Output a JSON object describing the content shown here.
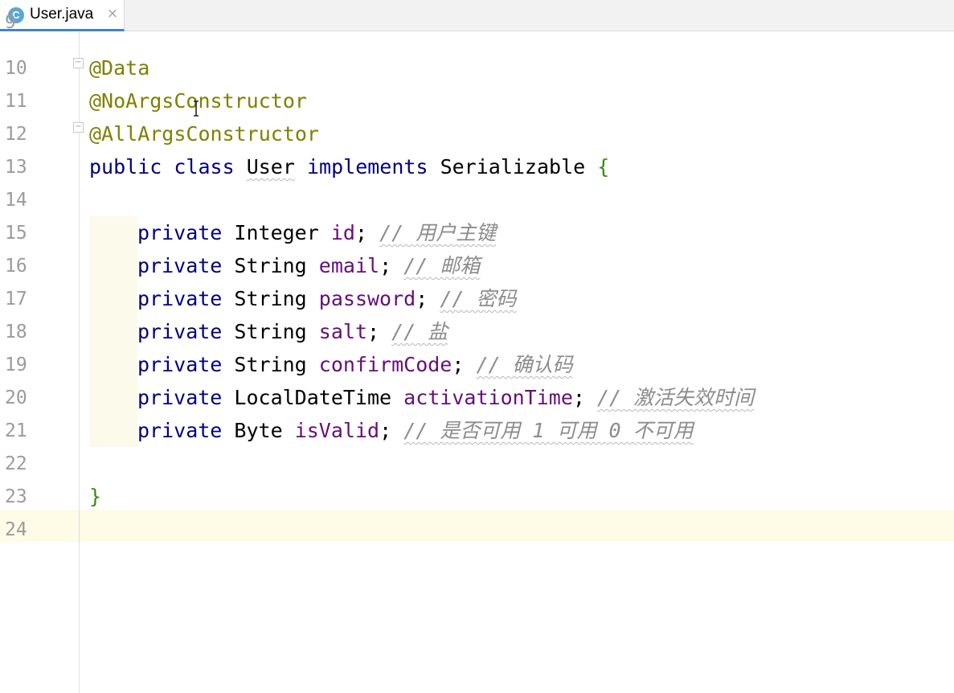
{
  "tab": {
    "icon_letter": "C",
    "title": "User.java",
    "close": "×"
  },
  "colors": {
    "keyword": "#000080",
    "annotation": "#808000",
    "field": "#660e7a",
    "comment": "#8c8c8c",
    "brace": "#3a8a19",
    "caret_line": "#fefbe6",
    "tab_accent": "#4083c9"
  },
  "editor": {
    "current_line": "24",
    "lines": [
      {
        "num": "9"
      },
      {
        "num": "10",
        "annotation": "@Data"
      },
      {
        "num": "11",
        "annotation": "@NoArgsConstructor"
      },
      {
        "num": "12",
        "annotation": "@AllArgsConstructor"
      },
      {
        "num": "13",
        "kw1": "public",
        "kw2": "class",
        "name": "User",
        "kw3": "implements",
        "iface": "Serializable",
        "brace": "{"
      },
      {
        "num": "14"
      },
      {
        "num": "15",
        "kw": "private",
        "type": "Integer",
        "name": "id",
        "semi": ";",
        "comment": "// 用户主键"
      },
      {
        "num": "16",
        "kw": "private",
        "type": "String",
        "name": "email",
        "semi": ";",
        "comment": "// 邮箱"
      },
      {
        "num": "17",
        "kw": "private",
        "type": "String",
        "name": "password",
        "semi": ";",
        "comment": "// 密码"
      },
      {
        "num": "18",
        "kw": "private",
        "type": "String",
        "name": "salt",
        "semi": ";",
        "comment": "// 盐"
      },
      {
        "num": "19",
        "kw": "private",
        "type": "String",
        "name": "confirmCode",
        "semi": ";",
        "comment": "// 确认码"
      },
      {
        "num": "20",
        "kw": "private",
        "type": "LocalDateTime",
        "name": "activationTime",
        "semi": ";",
        "comment": "// 激活失效时间"
      },
      {
        "num": "21",
        "kw": "private",
        "type": "Byte",
        "name": "isValid",
        "semi": ";",
        "comment": "// 是否可用 1 可用 0 不可用"
      },
      {
        "num": "22"
      },
      {
        "num": "23",
        "brace": "}"
      },
      {
        "num": "24"
      }
    ]
  }
}
